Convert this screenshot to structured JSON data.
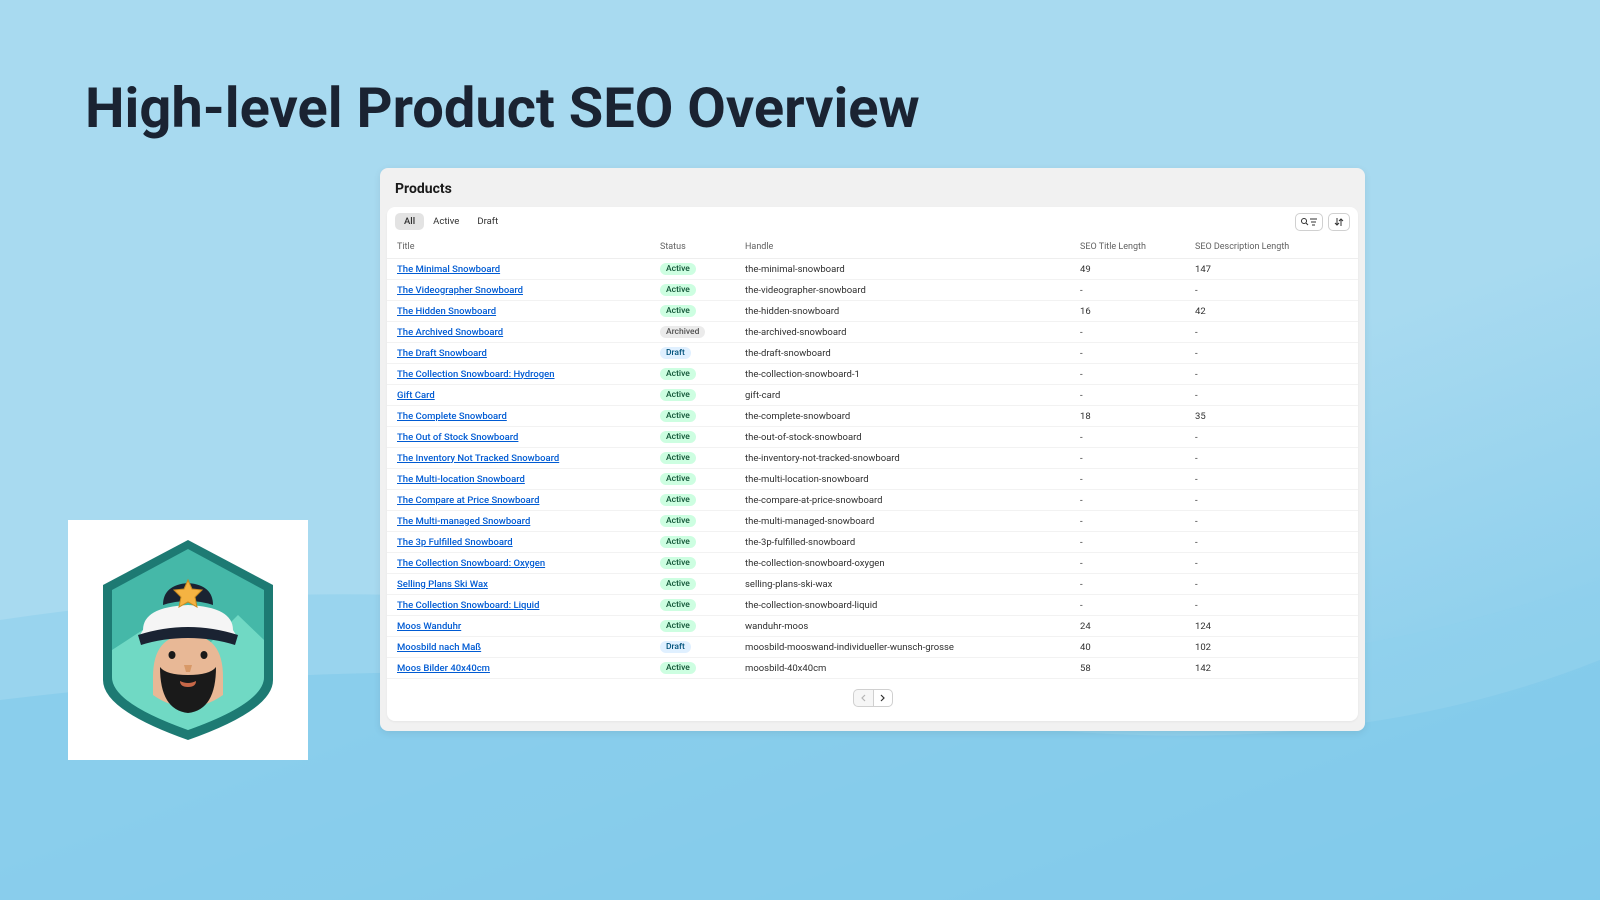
{
  "heading": "High-level Product SEO Overview",
  "panel_title": "Products",
  "tabs": {
    "all": "All",
    "active": "Active",
    "draft": "Draft"
  },
  "columns": {
    "title": "Title",
    "status": "Status",
    "handle": "Handle",
    "seo_title_length": "SEO Title Length",
    "seo_desc_length": "SEO Description Length"
  },
  "status_labels": {
    "Active": "Active",
    "Archived": "Archived",
    "Draft": "Draft"
  },
  "icons": {
    "search_filter": "search-filter-icon",
    "sort": "sort-icon",
    "prev": "chevron-left-icon",
    "next": "chevron-right-icon"
  },
  "rows": [
    {
      "title": "The Minimal Snowboard",
      "status": "Active",
      "handle": "the-minimal-snowboard",
      "tlen": "49",
      "dlen": "147"
    },
    {
      "title": "The Videographer Snowboard",
      "status": "Active",
      "handle": "the-videographer-snowboard",
      "tlen": "-",
      "dlen": "-"
    },
    {
      "title": "The Hidden Snowboard",
      "status": "Active",
      "handle": "the-hidden-snowboard",
      "tlen": "16",
      "dlen": "42"
    },
    {
      "title": "The Archived Snowboard",
      "status": "Archived",
      "handle": "the-archived-snowboard",
      "tlen": "-",
      "dlen": "-"
    },
    {
      "title": "The Draft Snowboard",
      "status": "Draft",
      "handle": "the-draft-snowboard",
      "tlen": "-",
      "dlen": "-"
    },
    {
      "title": "The Collection Snowboard: Hydrogen",
      "status": "Active",
      "handle": "the-collection-snowboard-1",
      "tlen": "-",
      "dlen": "-"
    },
    {
      "title": "Gift Card",
      "status": "Active",
      "handle": "gift-card",
      "tlen": "-",
      "dlen": "-"
    },
    {
      "title": "The Complete Snowboard",
      "status": "Active",
      "handle": "the-complete-snowboard",
      "tlen": "18",
      "dlen": "35"
    },
    {
      "title": "The Out of Stock Snowboard",
      "status": "Active",
      "handle": "the-out-of-stock-snowboard",
      "tlen": "-",
      "dlen": "-"
    },
    {
      "title": "The Inventory Not Tracked Snowboard",
      "status": "Active",
      "handle": "the-inventory-not-tracked-snowboard",
      "tlen": "-",
      "dlen": "-"
    },
    {
      "title": "The Multi-location Snowboard",
      "status": "Active",
      "handle": "the-multi-location-snowboard",
      "tlen": "-",
      "dlen": "-"
    },
    {
      "title": "The Compare at Price Snowboard",
      "status": "Active",
      "handle": "the-compare-at-price-snowboard",
      "tlen": "-",
      "dlen": "-"
    },
    {
      "title": "The Multi-managed Snowboard",
      "status": "Active",
      "handle": "the-multi-managed-snowboard",
      "tlen": "-",
      "dlen": "-"
    },
    {
      "title": "The 3p Fulfilled Snowboard",
      "status": "Active",
      "handle": "the-3p-fulfilled-snowboard",
      "tlen": "-",
      "dlen": "-"
    },
    {
      "title": "The Collection Snowboard: Oxygen",
      "status": "Active",
      "handle": "the-collection-snowboard-oxygen",
      "tlen": "-",
      "dlen": "-"
    },
    {
      "title": "Selling Plans Ski Wax",
      "status": "Active",
      "handle": "selling-plans-ski-wax",
      "tlen": "-",
      "dlen": "-"
    },
    {
      "title": "The Collection Snowboard: Liquid",
      "status": "Active",
      "handle": "the-collection-snowboard-liquid",
      "tlen": "-",
      "dlen": "-"
    },
    {
      "title": "Moos Wanduhr",
      "status": "Active",
      "handle": "wanduhr-moos",
      "tlen": "24",
      "dlen": "124"
    },
    {
      "title": "Moosbild nach Maß",
      "status": "Draft",
      "handle": "moosbild-mooswand-individueller-wunsch-grosse",
      "tlen": "40",
      "dlen": "102"
    },
    {
      "title": "Moos Bilder 40x40cm",
      "status": "Active",
      "handle": "moosbild-40x40cm",
      "tlen": "58",
      "dlen": "142"
    }
  ]
}
